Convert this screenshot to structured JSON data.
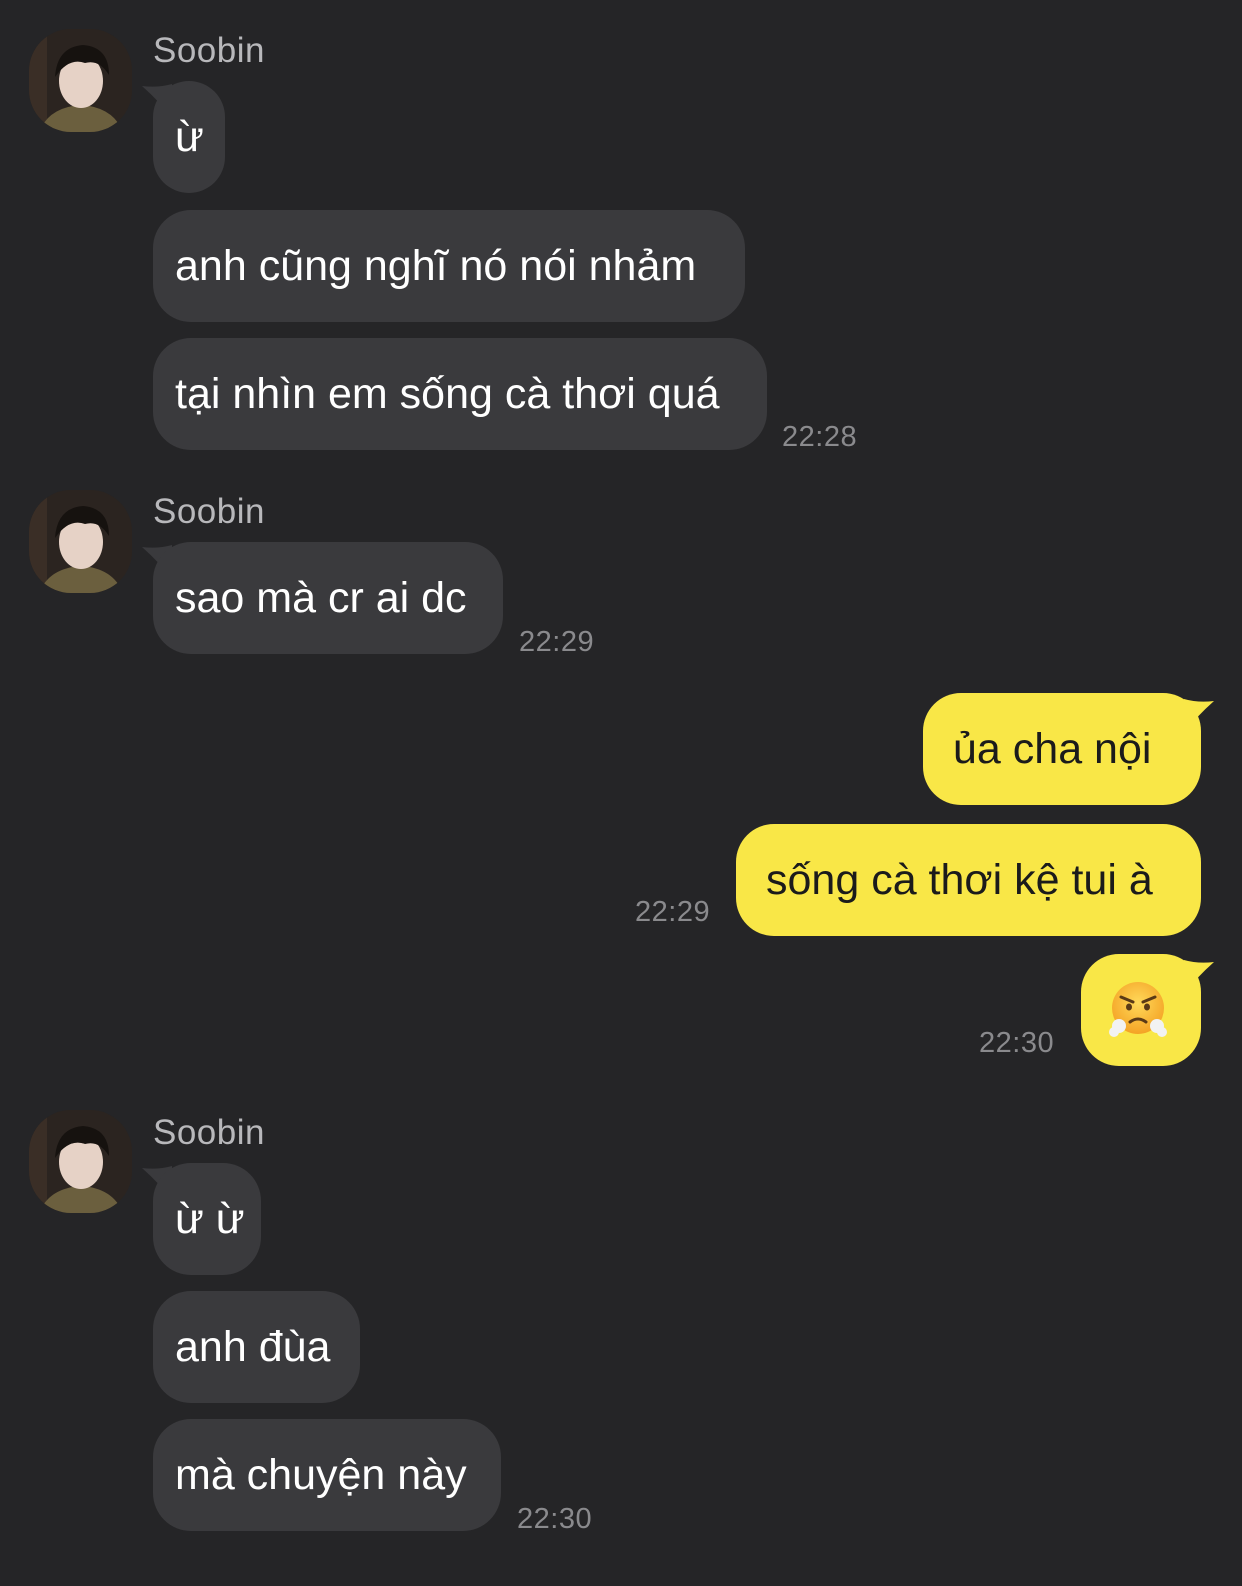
{
  "theme": {
    "background": "#252527",
    "incoming_bubble": "#3a3a3d",
    "outgoing_bubble": "#f9e747",
    "sender_color": "#b8b8bb",
    "time_color": "#8a8a8d"
  },
  "groups": [
    {
      "sender": "Soobin",
      "avatar": "profile-photo",
      "messages": [
        "ừ",
        "anh cũng nghĩ nó nói nhảm",
        "tại nhìn em sống cà thơi quá"
      ],
      "time": "22:28"
    },
    {
      "sender": "Soobin",
      "avatar": "profile-photo",
      "messages": [
        "sao mà cr ai dc"
      ],
      "time": "22:29"
    },
    {
      "sender": "me",
      "messages": [
        "ủa cha nội",
        "sống cà thơi kệ tui à"
      ],
      "time": "22:29"
    },
    {
      "sender": "me",
      "messages": [
        "😤"
      ],
      "emoji_icon": "face-with-steam-from-nose-icon",
      "time": "22:30"
    },
    {
      "sender": "Soobin",
      "avatar": "profile-photo",
      "messages": [
        "ừ ừ",
        "anh đùa",
        "mà chuyện này"
      ],
      "time": "22:30"
    }
  ]
}
